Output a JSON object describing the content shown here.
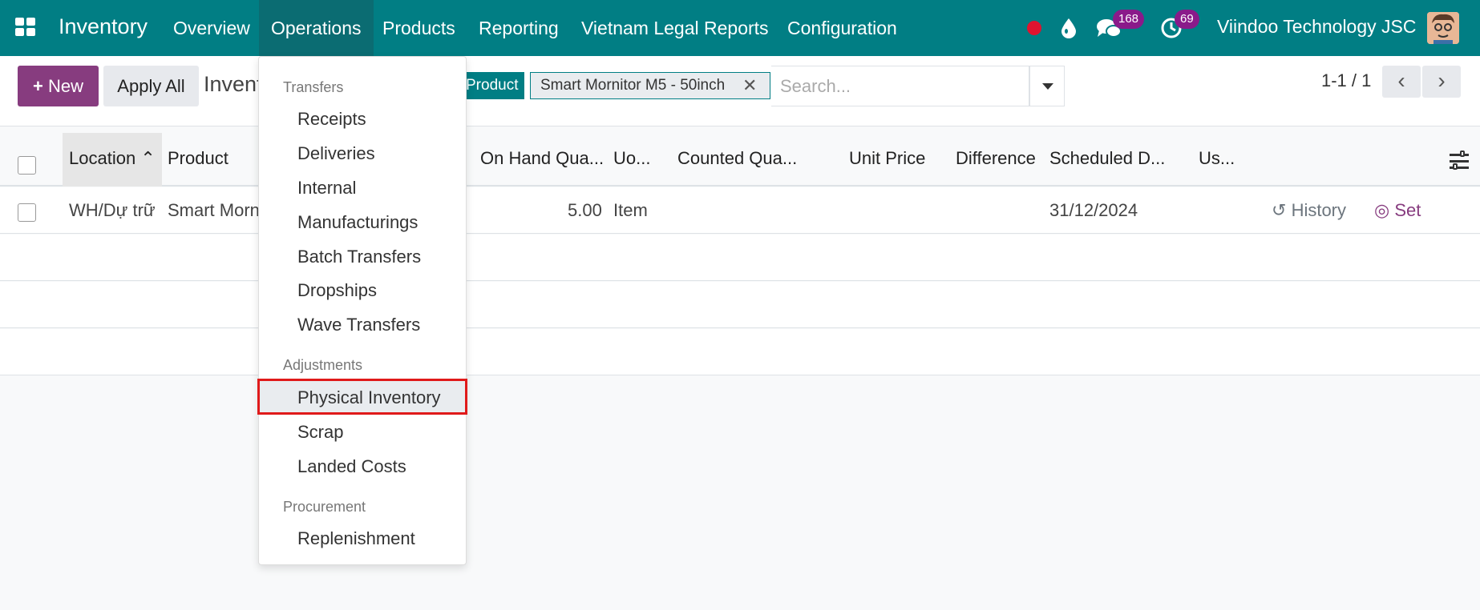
{
  "navbar": {
    "app_title": "Inventory",
    "menu": [
      "Overview",
      "Operations",
      "Products",
      "Reporting",
      "Vietnam Legal Reports",
      "Configuration"
    ],
    "messages_badge": "168",
    "activities_badge": "69",
    "company": "Viindoo Technology JSC"
  },
  "control": {
    "new_label": "New",
    "apply_all_label": "Apply All",
    "breadcrumb": "Invent",
    "facet_label": "Product",
    "facet_value": "Smart Mornitor M5 - 50inch",
    "search_placeholder": "Search...",
    "pager": "1-1 / 1"
  },
  "table": {
    "columns": [
      "Location",
      "Product",
      "On Hand Qua...",
      "Uo...",
      "Counted Qua...",
      "Unit Price",
      "Difference",
      "Scheduled D...",
      "Us..."
    ],
    "row": {
      "location": "WH/Dự trữ",
      "product": "Smart Morn",
      "on_hand": "5.00",
      "uom": "Item",
      "scheduled": "31/12/2024",
      "history": "History",
      "set": "Set"
    }
  },
  "dropdown": {
    "sections": [
      {
        "header": "Transfers",
        "items": [
          "Receipts",
          "Deliveries",
          "Internal",
          "Manufacturings",
          "Batch Transfers",
          "Dropships",
          "Wave Transfers"
        ]
      },
      {
        "header": "Adjustments",
        "items": [
          "Physical Inventory",
          "Scrap",
          "Landed Costs"
        ]
      },
      {
        "header": "Procurement",
        "items": [
          "Replenishment"
        ]
      }
    ]
  },
  "colors": {
    "navbar": "#017e84",
    "primary_button": "#873c7f",
    "highlight_border": "#e01a1a",
    "badge": "#8a1a8a"
  }
}
